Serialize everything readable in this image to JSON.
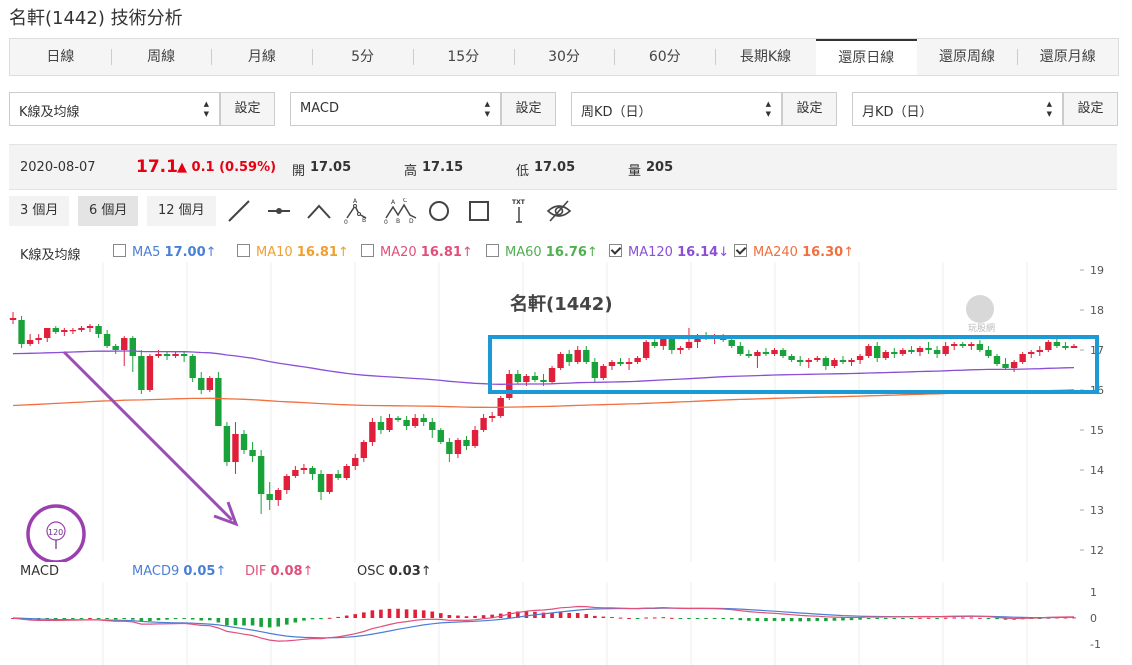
{
  "page_title": "名軒(1442) 技術分析",
  "tabs": [
    {
      "label": "日線",
      "active": false
    },
    {
      "label": "周線",
      "active": false
    },
    {
      "label": "月線",
      "active": false
    },
    {
      "label": "5分",
      "active": false
    },
    {
      "label": "15分",
      "active": false
    },
    {
      "label": "30分",
      "active": false
    },
    {
      "label": "60分",
      "active": false
    },
    {
      "label": "長期K線",
      "active": false
    },
    {
      "label": "還原日線",
      "active": true
    },
    {
      "label": "還原周線",
      "active": false
    },
    {
      "label": "還原月線",
      "active": false
    }
  ],
  "selectors": [
    {
      "value": "K線及均線",
      "button": "設定"
    },
    {
      "value": "MACD",
      "button": "設定"
    },
    {
      "value": "周KD（日）",
      "button": "設定"
    },
    {
      "value": "月KD（日）",
      "button": "設定"
    }
  ],
  "quote": {
    "date": "2020-08-07",
    "price": "17.1",
    "change": "▲ 0.1 (0.59%)",
    "open_label": "開",
    "open": "17.05",
    "high_label": "高",
    "high": "17.15",
    "low_label": "低",
    "low": "17.05",
    "vol_label": "量",
    "vol": "205"
  },
  "ranges": [
    {
      "label": "3 個月",
      "active": false
    },
    {
      "label": "6 個月",
      "active": true
    },
    {
      "label": "12 個月",
      "active": false
    }
  ],
  "tools": [
    "line-tool-icon",
    "segment-tool-icon",
    "angle-tool-icon",
    "abc-pattern-icon",
    "abcd-pattern-icon",
    "circle-tool-icon",
    "rectangle-tool-icon",
    "text-tool-icon",
    "hide-drawings-icon"
  ],
  "tool_text": {
    "text_tool": "TXT",
    "a": "A",
    "b": "B",
    "c": "C",
    "d": "D",
    "zero": "0"
  },
  "ma_legend": {
    "label": "K線及均線",
    "items": [
      {
        "name": "MA5",
        "value": "17.00",
        "arrow": "↑",
        "checked": false,
        "color": "#4a7fd6"
      },
      {
        "name": "MA10",
        "value": "16.81",
        "arrow": "↑",
        "checked": false,
        "color": "#f0a030"
      },
      {
        "name": "MA20",
        "value": "16.81",
        "arrow": "↑",
        "checked": false,
        "color": "#e0507a"
      },
      {
        "name": "MA60",
        "value": "16.76",
        "arrow": "↑",
        "checked": false,
        "color": "#4fb04f"
      },
      {
        "name": "MA120",
        "value": "16.14",
        "arrow": "↓",
        "checked": true,
        "color": "#8a4fd6"
      },
      {
        "name": "MA240",
        "value": "16.30",
        "arrow": "↑",
        "checked": true,
        "color": "#f07040"
      }
    ]
  },
  "chart_data": {
    "type": "candlestick",
    "title": "名軒(1442)",
    "watermark": "玩股網",
    "y_ticks": [
      19,
      18,
      17,
      16,
      15,
      14,
      13,
      12
    ],
    "ylim": [
      12,
      19
    ],
    "colors": {
      "up": "#e0203a",
      "down": "#1aa23a",
      "ma120": "#8a4fd6",
      "ma240": "#f07040"
    },
    "annotation_badge": "120",
    "ohlc": [
      [
        17.75,
        17.95,
        17.65,
        17.8
      ],
      [
        17.75,
        17.85,
        17.05,
        17.15
      ],
      [
        17.15,
        17.4,
        17.1,
        17.25
      ],
      [
        17.25,
        17.4,
        17.15,
        17.3
      ],
      [
        17.3,
        17.45,
        17.2,
        17.55
      ],
      [
        17.55,
        17.6,
        17.4,
        17.45
      ],
      [
        17.45,
        17.55,
        17.35,
        17.5
      ],
      [
        17.5,
        17.55,
        17.4,
        17.5
      ],
      [
        17.5,
        17.6,
        17.45,
        17.55
      ],
      [
        17.55,
        17.65,
        17.45,
        17.6
      ],
      [
        17.6,
        17.65,
        17.3,
        17.4
      ],
      [
        17.4,
        17.5,
        17.05,
        17.1
      ],
      [
        17.1,
        17.15,
        16.9,
        17.0
      ],
      [
        17.0,
        17.35,
        16.6,
        17.3
      ],
      [
        17.3,
        17.35,
        16.45,
        16.85
      ],
      [
        16.85,
        17.0,
        15.9,
        16.0
      ],
      [
        16.0,
        16.9,
        15.95,
        16.85
      ],
      [
        16.85,
        17.0,
        16.8,
        16.9
      ],
      [
        16.9,
        16.95,
        16.75,
        16.85
      ],
      [
        16.85,
        16.95,
        16.8,
        16.9
      ],
      [
        16.9,
        16.95,
        16.7,
        16.85
      ],
      [
        16.85,
        16.9,
        16.2,
        16.3
      ],
      [
        16.3,
        16.45,
        15.9,
        16.0
      ],
      [
        16.0,
        16.35,
        15.95,
        16.3
      ],
      [
        16.3,
        16.45,
        15.5,
        15.1
      ],
      [
        15.1,
        15.2,
        14.1,
        14.2
      ],
      [
        14.2,
        15.2,
        13.9,
        14.9
      ],
      [
        14.9,
        15.0,
        14.4,
        14.5
      ],
      [
        14.5,
        14.7,
        14.2,
        14.35
      ],
      [
        14.35,
        14.5,
        12.9,
        13.4
      ],
      [
        13.4,
        13.7,
        13.0,
        13.25
      ],
      [
        13.25,
        13.55,
        13.1,
        13.5
      ],
      [
        13.5,
        13.9,
        13.4,
        13.85
      ],
      [
        13.85,
        14.1,
        13.8,
        14.0
      ],
      [
        14.0,
        14.15,
        13.9,
        14.05
      ],
      [
        14.05,
        14.1,
        13.75,
        13.9
      ],
      [
        13.9,
        14.0,
        13.25,
        13.45
      ],
      [
        13.45,
        13.9,
        13.4,
        13.9
      ],
      [
        13.9,
        14.0,
        13.75,
        13.8
      ],
      [
        13.8,
        14.15,
        13.75,
        14.1
      ],
      [
        14.1,
        14.4,
        14.0,
        14.3
      ],
      [
        14.3,
        14.75,
        14.2,
        14.7
      ],
      [
        14.7,
        15.3,
        14.6,
        15.2
      ],
      [
        15.2,
        15.35,
        14.9,
        15.0
      ],
      [
        15.0,
        15.4,
        14.95,
        15.3
      ],
      [
        15.3,
        15.35,
        15.2,
        15.25
      ],
      [
        15.25,
        15.35,
        15.0,
        15.1
      ],
      [
        15.1,
        15.4,
        15.05,
        15.3
      ],
      [
        15.3,
        15.4,
        15.1,
        15.2
      ],
      [
        15.2,
        15.3,
        14.8,
        15.0
      ],
      [
        15.0,
        15.05,
        14.65,
        14.7
      ],
      [
        14.7,
        14.8,
        14.2,
        14.4
      ],
      [
        14.4,
        14.8,
        14.3,
        14.75
      ],
      [
        14.75,
        14.85,
        14.5,
        14.6
      ],
      [
        14.6,
        15.1,
        14.55,
        15.0
      ],
      [
        15.0,
        15.4,
        14.95,
        15.3
      ],
      [
        15.3,
        15.45,
        15.2,
        15.35
      ],
      [
        15.35,
        15.85,
        15.3,
        15.8
      ],
      [
        15.8,
        16.5,
        15.75,
        16.4
      ],
      [
        16.4,
        16.5,
        16.15,
        16.2
      ],
      [
        16.2,
        16.4,
        16.1,
        16.35
      ],
      [
        16.35,
        16.45,
        16.2,
        16.25
      ],
      [
        16.25,
        16.4,
        16.1,
        16.2
      ],
      [
        16.2,
        16.6,
        16.15,
        16.55
      ],
      [
        16.55,
        16.95,
        16.5,
        16.9
      ],
      [
        16.9,
        17.0,
        16.6,
        16.7
      ],
      [
        16.7,
        17.1,
        16.65,
        17.0
      ],
      [
        17.0,
        17.1,
        16.65,
        16.7
      ],
      [
        16.7,
        16.8,
        16.2,
        16.3
      ],
      [
        16.3,
        16.65,
        16.25,
        16.6
      ],
      [
        16.6,
        16.75,
        16.5,
        16.7
      ],
      [
        16.7,
        16.8,
        16.6,
        16.65
      ],
      [
        16.65,
        16.8,
        16.5,
        16.7
      ],
      [
        16.7,
        16.85,
        16.65,
        16.8
      ],
      [
        16.8,
        17.25,
        16.75,
        17.2
      ],
      [
        17.2,
        17.3,
        17.05,
        17.1
      ],
      [
        17.1,
        17.35,
        17.0,
        17.3
      ],
      [
        17.3,
        17.35,
        16.9,
        17.0
      ],
      [
        17.0,
        17.1,
        16.9,
        17.05
      ],
      [
        17.05,
        17.55,
        17.0,
        17.2
      ],
      [
        17.2,
        17.4,
        17.05,
        17.35
      ],
      [
        17.35,
        17.45,
        17.25,
        17.3
      ],
      [
        17.3,
        17.4,
        17.15,
        17.35
      ],
      [
        17.35,
        17.4,
        17.2,
        17.25
      ],
      [
        17.25,
        17.3,
        17.05,
        17.1
      ],
      [
        17.1,
        17.2,
        16.85,
        16.9
      ],
      [
        16.9,
        17.0,
        16.8,
        16.85
      ],
      [
        16.85,
        17.0,
        16.55,
        16.95
      ],
      [
        16.95,
        17.05,
        16.85,
        16.9
      ],
      [
        16.9,
        17.05,
        16.85,
        17.0
      ],
      [
        17.0,
        17.05,
        16.8,
        16.85
      ],
      [
        16.85,
        16.9,
        16.7,
        16.75
      ],
      [
        16.75,
        16.85,
        16.6,
        16.7
      ],
      [
        16.7,
        16.8,
        16.55,
        16.75
      ],
      [
        16.75,
        16.85,
        16.7,
        16.8
      ],
      [
        16.8,
        16.85,
        16.5,
        16.6
      ],
      [
        16.6,
        16.8,
        16.55,
        16.75
      ],
      [
        16.75,
        16.85,
        16.65,
        16.7
      ],
      [
        16.7,
        16.8,
        16.6,
        16.75
      ],
      [
        16.75,
        16.9,
        16.65,
        16.85
      ],
      [
        16.85,
        17.15,
        16.8,
        17.1
      ],
      [
        17.1,
        17.2,
        16.7,
        16.8
      ],
      [
        16.8,
        17.0,
        16.75,
        16.95
      ],
      [
        16.95,
        17.05,
        16.8,
        16.9
      ],
      [
        16.9,
        17.05,
        16.85,
        17.0
      ],
      [
        17.0,
        17.1,
        16.9,
        16.95
      ],
      [
        16.95,
        17.1,
        16.85,
        17.05
      ],
      [
        17.05,
        17.2,
        16.9,
        17.0
      ],
      [
        17.0,
        17.1,
        16.8,
        16.9
      ],
      [
        16.9,
        17.2,
        16.85,
        17.1
      ],
      [
        17.1,
        17.2,
        17.0,
        17.15
      ],
      [
        17.15,
        17.2,
        17.05,
        17.1
      ],
      [
        17.1,
        17.2,
        17.0,
        17.15
      ],
      [
        17.15,
        17.25,
        16.95,
        17.0
      ],
      [
        17.0,
        17.1,
        16.8,
        16.85
      ],
      [
        16.85,
        16.9,
        16.6,
        16.65
      ],
      [
        16.65,
        16.8,
        16.5,
        16.55
      ],
      [
        16.55,
        16.75,
        16.45,
        16.7
      ],
      [
        16.7,
        16.95,
        16.65,
        16.9
      ],
      [
        16.9,
        17.0,
        16.8,
        16.95
      ],
      [
        16.95,
        17.1,
        16.85,
        17.0
      ],
      [
        17.0,
        17.25,
        16.95,
        17.2
      ],
      [
        17.2,
        17.3,
        17.05,
        17.1
      ],
      [
        17.1,
        17.2,
        17.0,
        17.05
      ],
      [
        17.05,
        17.15,
        17.05,
        17.1
      ]
    ]
  },
  "macd_legend": {
    "label": "MACD",
    "items": [
      {
        "name": "MACD9",
        "value": "0.05",
        "arrow": "↑",
        "color": "#4a7fd6"
      },
      {
        "name": "DIF",
        "value": "0.08",
        "arrow": "↑",
        "color": "#e0507a"
      },
      {
        "name": "OSC",
        "value": "0.03",
        "arrow": "↑",
        "color": "#333333"
      }
    ],
    "y_ticks": [
      1,
      0,
      -1
    ],
    "ylim": [
      -1.2,
      1.2
    ]
  }
}
